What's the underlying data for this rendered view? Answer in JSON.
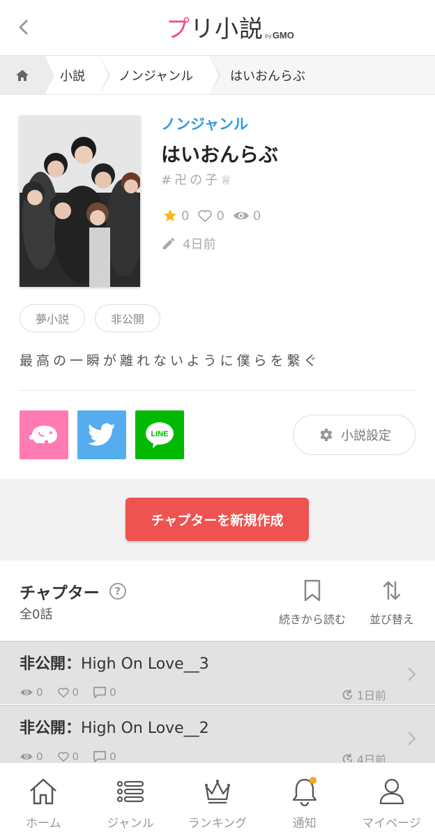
{
  "header": {
    "logo_main_a": "プ",
    "logo_main_b": "リ小説",
    "logo_by": "by",
    "logo_gmo": "GMO"
  },
  "breadcrumb": {
    "items": [
      "小説",
      "ノンジャンル",
      "はいおんらぶ"
    ]
  },
  "novel": {
    "genre": "ノンジャンル",
    "title": "はいおんらぶ",
    "author": "#卍の子♕",
    "stars": "0",
    "likes": "0",
    "views": "0",
    "updated": "4日前",
    "tags": [
      "夢小説",
      "非公開"
    ],
    "description": "最高の一瞬が離れないように僕らを繋ぐ"
  },
  "share": {
    "line_label": "LINE",
    "settings_label": "小説設定"
  },
  "create_button": "チャプターを新規作成",
  "chapters_section": {
    "title": "チャプター",
    "help": "?",
    "count": "全0話",
    "continue_label": "続きから読む",
    "sort_label": "並び替え"
  },
  "chapters": [
    {
      "status": "非公開：",
      "title": "High On Love__3",
      "views": "0",
      "likes": "0",
      "comments": "0",
      "updated": "1日前"
    },
    {
      "status": "非公開：",
      "title": "High On Love__2",
      "views": "0",
      "likes": "0",
      "comments": "0",
      "updated": "4日前"
    }
  ],
  "bottom_nav": [
    {
      "label": "ホーム"
    },
    {
      "label": "ジャンル"
    },
    {
      "label": "ランキング"
    },
    {
      "label": "通知"
    },
    {
      "label": "マイページ"
    }
  ],
  "colors": {
    "genre_blue": "#2f9be0",
    "create_red": "#ef5350",
    "star_yellow": "#f5b921",
    "notify_dot": "#f5a623"
  }
}
